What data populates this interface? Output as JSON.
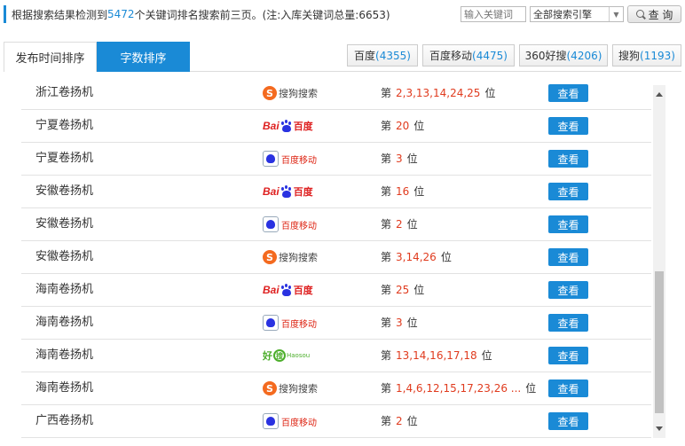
{
  "header": {
    "summary_prefix": "根据搜索结果检测到",
    "keyword_count": "5472",
    "summary_suffix": "个关键词排名搜索前三页。(注:入库关键词总量:6653)",
    "search_placeholder": "输入关键词",
    "engine_select": "全部搜索引擎",
    "query_label": "查 询"
  },
  "tabs": [
    {
      "label": "发布时间排序",
      "active": false
    },
    {
      "label": "字数排序",
      "active": true
    }
  ],
  "engine_tabs": [
    {
      "name": "百度",
      "count": "(4355)"
    },
    {
      "name": "百度移动",
      "count": "(4475)"
    },
    {
      "name": "360好搜",
      "count": "(4206)"
    },
    {
      "name": "搜狗",
      "count": "(1193)"
    }
  ],
  "rows": [
    {
      "keyword": "浙江卷扬机",
      "engine": "sogou",
      "rank_prefix": "第",
      "positions": "2,3,13,14,24,25",
      "rank_suffix": "位",
      "action": "查看"
    },
    {
      "keyword": "宁夏卷扬机",
      "engine": "baidu",
      "rank_prefix": "第",
      "positions": "20",
      "rank_suffix": "位",
      "action": "查看"
    },
    {
      "keyword": "宁夏卷扬机",
      "engine": "baidu-mobile",
      "rank_prefix": "第",
      "positions": "3",
      "rank_suffix": "位",
      "action": "查看"
    },
    {
      "keyword": "安徽卷扬机",
      "engine": "baidu",
      "rank_prefix": "第",
      "positions": "16",
      "rank_suffix": "位",
      "action": "查看"
    },
    {
      "keyword": "安徽卷扬机",
      "engine": "baidu-mobile",
      "rank_prefix": "第",
      "positions": "2",
      "rank_suffix": "位",
      "action": "查看"
    },
    {
      "keyword": "安徽卷扬机",
      "engine": "sogou",
      "rank_prefix": "第",
      "positions": "3,14,26",
      "rank_suffix": "位",
      "action": "查看"
    },
    {
      "keyword": "海南卷扬机",
      "engine": "baidu",
      "rank_prefix": "第",
      "positions": "25",
      "rank_suffix": "位",
      "action": "查看"
    },
    {
      "keyword": "海南卷扬机",
      "engine": "baidu-mobile",
      "rank_prefix": "第",
      "positions": "3",
      "rank_suffix": "位",
      "action": "查看"
    },
    {
      "keyword": "海南卷扬机",
      "engine": "haosou",
      "rank_prefix": "第",
      "positions": "13,14,16,17,18",
      "rank_suffix": "位",
      "action": "查看"
    },
    {
      "keyword": "海南卷扬机",
      "engine": "sogou",
      "rank_prefix": "第",
      "positions": "1,4,6,12,15,17,23,26 ...",
      "rank_suffix": "位",
      "action": "查看"
    },
    {
      "keyword": "广西卷扬机",
      "engine": "baidu-mobile",
      "rank_prefix": "第",
      "positions": "2",
      "rank_suffix": "位",
      "action": "查看"
    }
  ],
  "logos": {
    "sogou_badge": "S",
    "sogou_text": "搜狗搜索",
    "baidu_bai": "Bai",
    "baidu_du": "百度",
    "baidu_mobile_text": "百度移动",
    "haosou_hao": "好",
    "haosou_sou": "搜",
    "haosou_en": "Haosou"
  },
  "colors": {
    "accent": "#1a8ad6",
    "rank_red": "#e03b1e"
  }
}
